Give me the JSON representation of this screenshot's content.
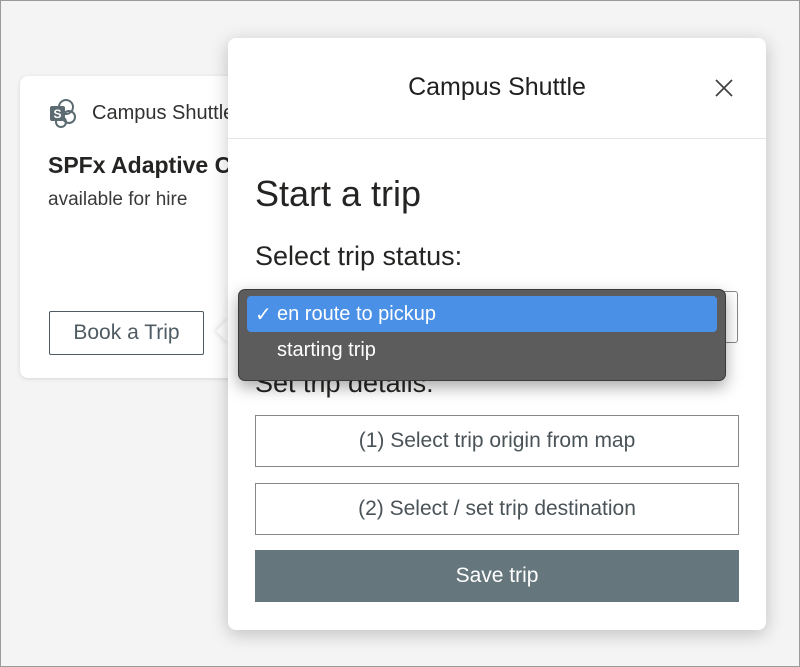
{
  "card": {
    "app_name": "Campus Shuttle",
    "title": "SPFx Adaptive Card Extension",
    "subtitle": "available for hire",
    "book_button_label": "Book a Trip"
  },
  "dialog": {
    "title": "Campus Shuttle",
    "heading": "Start a trip",
    "status_label": "Select trip status:",
    "details_label": "Set trip details:",
    "origin_button_label": "(1) Select trip origin from map",
    "destination_button_label": "(2) Select / set trip destination",
    "save_button_label": "Save trip"
  },
  "status_dropdown": {
    "options": [
      {
        "label": "en route to pickup",
        "selected": true
      },
      {
        "label": "starting trip",
        "selected": false
      }
    ]
  },
  "colors": {
    "save_button": "#66767d",
    "dropdown_highlight": "#4a90e6",
    "dropdown_background": "#5c5c5c"
  },
  "icons": {
    "card_icon": "sharepoint-icon",
    "close": "close-icon",
    "check": "checkmark-icon"
  }
}
